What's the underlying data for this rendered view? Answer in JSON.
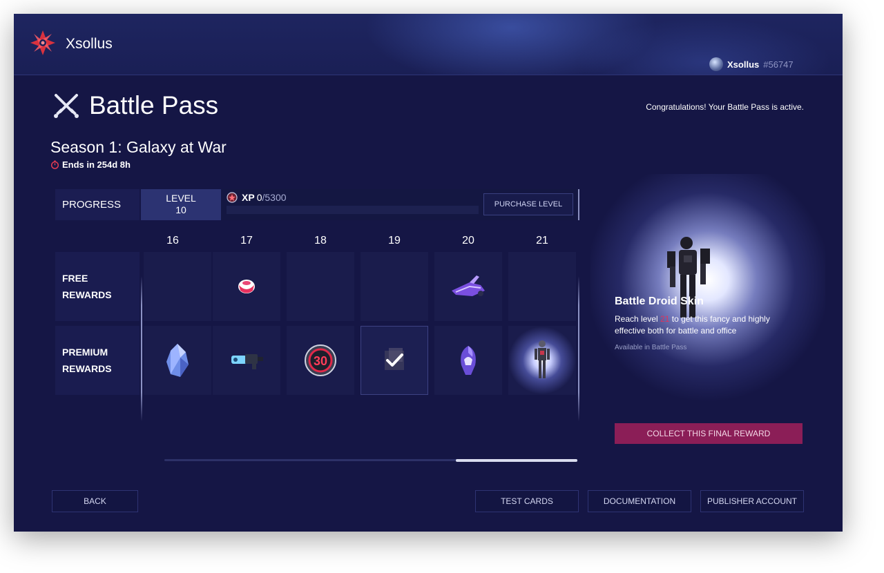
{
  "header": {
    "brand": "Xsollus",
    "user_name": "Xsollus",
    "user_id": "#56747",
    "icons": {
      "logo": "xsolla-star-logo",
      "avatar": "user-avatar"
    }
  },
  "page": {
    "title": "Battle Pass",
    "title_icon": "crossed-swords-icon",
    "status_message": "Congratulations! Your Battle Pass is active.",
    "season_title": "Season 1: Galaxy at War",
    "ends_in": "Ends in 254d 8h",
    "ends_icon": "stopwatch-icon"
  },
  "progress": {
    "label": "PROGRESS",
    "level_label": "LEVEL",
    "level_value": "10",
    "xp_label": "XP",
    "xp_current": "0",
    "xp_total": "/5300",
    "xp_fraction": 0,
    "purchase_button": "PURCHASE LEVEL"
  },
  "levels": [
    "16",
    "17",
    "18",
    "19",
    "20",
    "21"
  ],
  "rows": {
    "free_label_line1": "FREE",
    "free_label_line2": "REWARDS",
    "premium_label_line1": "PREMIUM",
    "premium_label_line2": "REWARDS"
  },
  "free_rewards": [
    "",
    "gem-capsule-icon",
    "",
    "",
    "hover-bike-icon",
    ""
  ],
  "premium_rewards": [
    "crystal-icon",
    "blaster-gun-icon",
    "level-30-badge-icon",
    "claimed-check-icon",
    "alien-helmet-icon",
    "battle-droid-icon"
  ],
  "premium_badge_text": "30",
  "scroll": {
    "position_fraction": 0.71
  },
  "feature": {
    "title": "Battle Droid Skin",
    "desc_before": "Reach level ",
    "desc_level": "21",
    "desc_after": " to get this fancy and highly effective both for battle and office",
    "availability": "Available in Battle Pass",
    "collect_button": "COLLECT THIS FINAL REWARD"
  },
  "footer": {
    "back": "BACK",
    "test_cards": "TEST CARDS",
    "documentation": "DOCUMENTATION",
    "publisher_account": "PUBLISHER ACCOUNT"
  },
  "colors": {
    "background": "#151645",
    "accent": "#8b1e57",
    "highlight": "#e0335d"
  }
}
